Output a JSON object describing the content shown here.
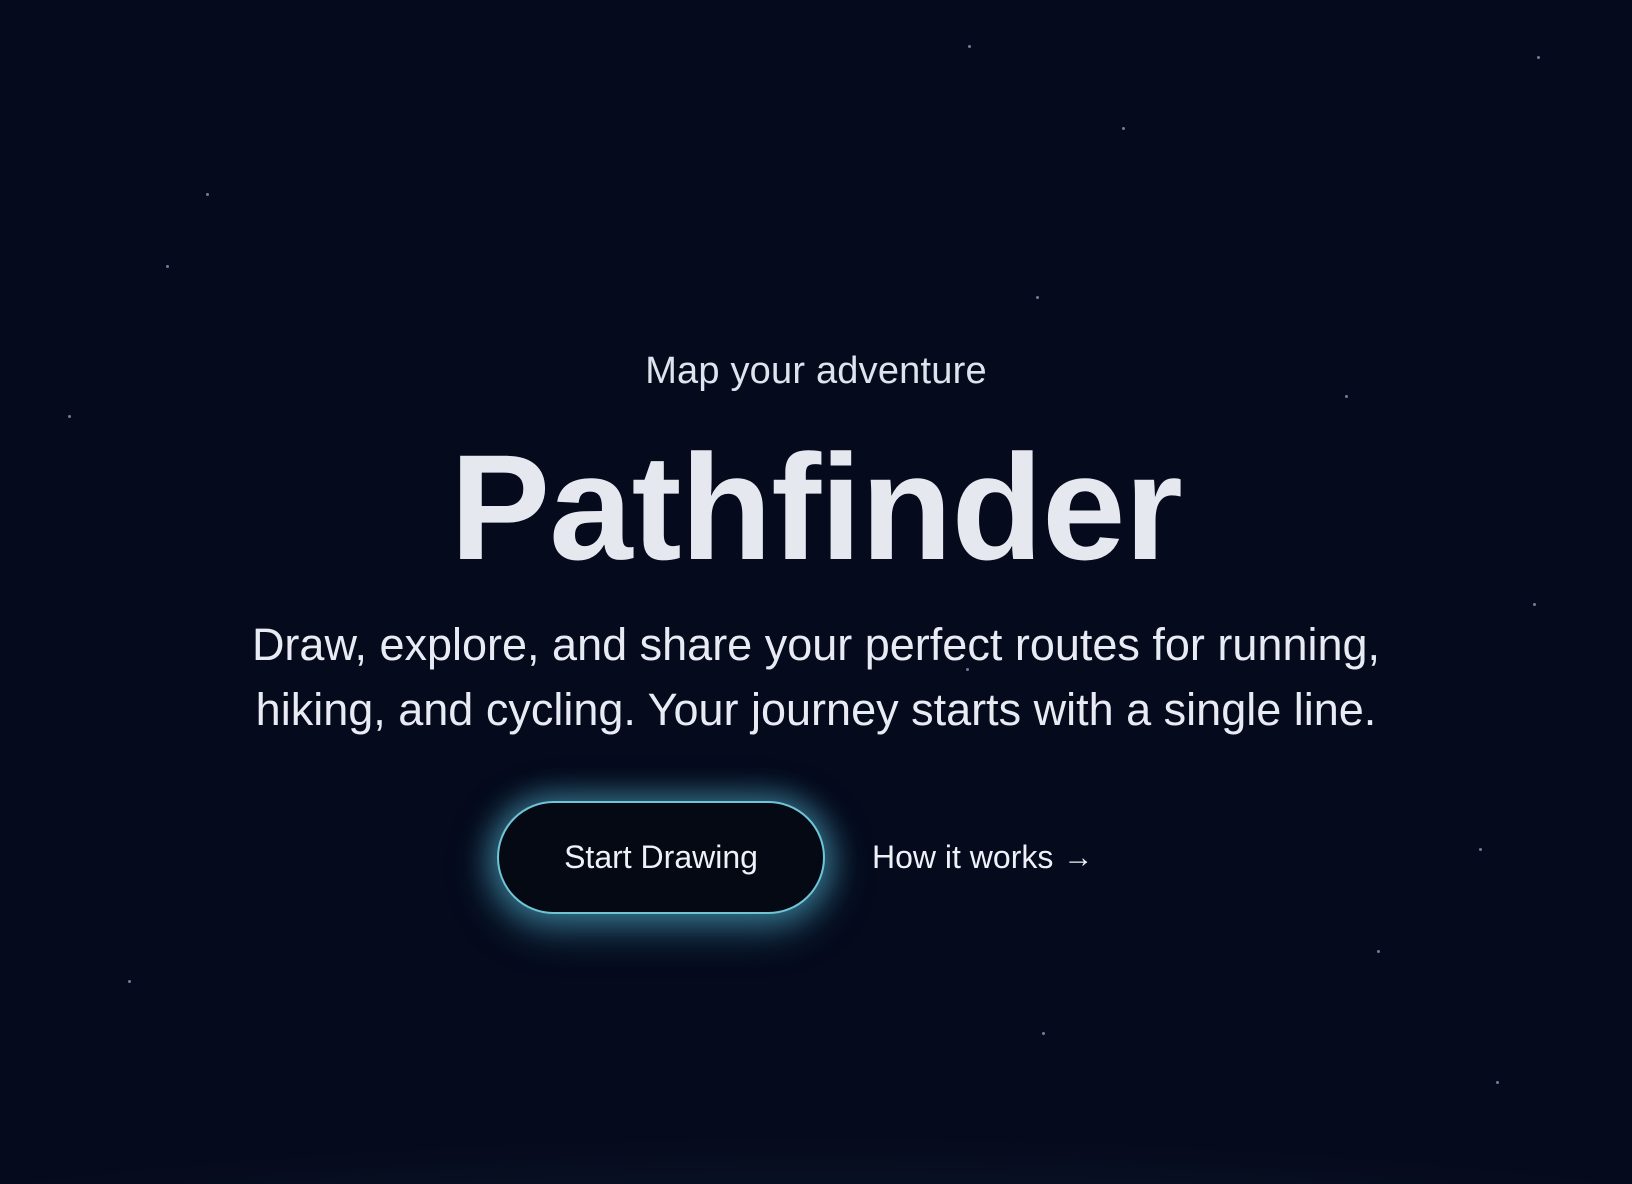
{
  "hero": {
    "eyebrow": "Map your adventure",
    "title": "Pathfinder",
    "tagline": "Draw, explore, and share your perfect routes for running, hiking, and cycling. Your journey starts with a single line.",
    "primary_button": "Start Drawing",
    "secondary_link": "How it works",
    "secondary_link_icon": "arrow-right-icon"
  },
  "colors": {
    "background": "#050a1c",
    "text": "#e8ebf3",
    "button_glow": "#6fc4d6",
    "horizon_glow": "#2e6e82"
  }
}
